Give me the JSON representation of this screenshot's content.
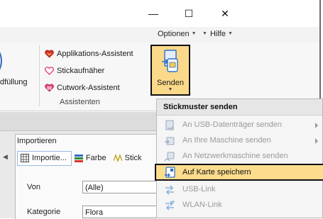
{
  "window": {
    "minimize_glyph": "—",
    "maximize_glyph": "☐",
    "close_glyph": "✕"
  },
  "menubar": {
    "options_label": "Optionen",
    "help_label": "Hilfe"
  },
  "ribbon": {
    "partial_label": "dfüllung",
    "items": [
      {
        "label": "Applikations-Assistent",
        "icon": "heart-filled-icon"
      },
      {
        "label": "Stickaufnäher",
        "icon": "heart-outline-icon"
      },
      {
        "label": "Cutwork-Assistent",
        "icon": "heart-cutwork-icon"
      }
    ],
    "group_label": "Assistenten",
    "send_button_label": "Senden"
  },
  "lower_panel": {
    "header": "Importieren",
    "subtabs": [
      {
        "label": "Importie...",
        "icon": "grid-icon"
      },
      {
        "label": "Farbe",
        "icon": "color-icon"
      },
      {
        "label": "Stick",
        "icon": "stitch-icon"
      }
    ],
    "fields": [
      {
        "label": "Von",
        "value": "(Alle)"
      },
      {
        "label": "Kategorie",
        "value": "Flora"
      }
    ]
  },
  "dropdown": {
    "title": "Stickmuster senden",
    "items": [
      {
        "label": "An USB-Datenträger senden",
        "enabled": false,
        "submenu": true,
        "icon": "usb-drive-icon"
      },
      {
        "label": "An Ihre Maschine senden",
        "enabled": false,
        "submenu": true,
        "icon": "machine-icon"
      },
      {
        "label": "An Netzwerkmaschine senden",
        "enabled": false,
        "submenu": false,
        "icon": "network-machine-icon"
      },
      {
        "label": "Auf Karte speichern",
        "enabled": true,
        "submenu": false,
        "highlighted": true,
        "icon": "save-card-icon"
      },
      {
        "label": "USB-Link",
        "enabled": false,
        "submenu": false,
        "icon": "usb-link-icon"
      },
      {
        "label": "WLAN-Link",
        "enabled": false,
        "submenu": false,
        "icon": "wlan-link-icon"
      }
    ]
  },
  "colors": {
    "highlight": "#fcdc8d",
    "send_button_bg": "#fbd98a",
    "heart_red": "#d9342b",
    "heart_pink": "#e8457a",
    "icon_blue": "#2f6fc4",
    "disabled_text": "#9a9a9a"
  }
}
